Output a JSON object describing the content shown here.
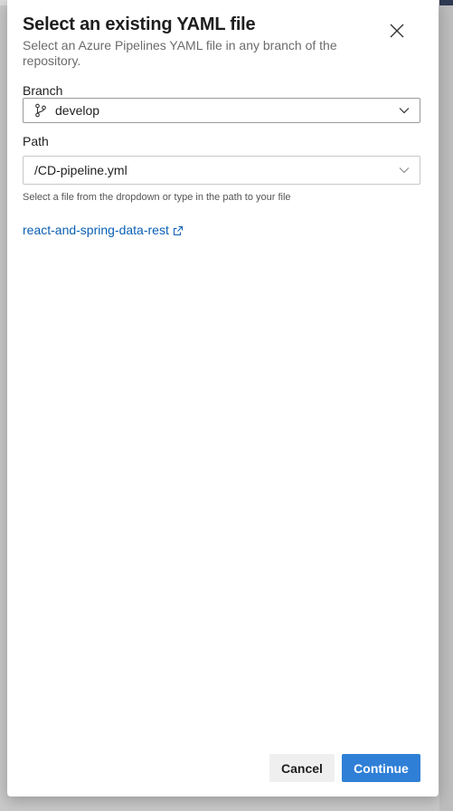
{
  "dialog": {
    "title": "Select an existing YAML file",
    "subtitle": "Select an Azure Pipelines YAML file in any branch of the repository.",
    "close_icon": "close-icon"
  },
  "branch": {
    "label": "Branch",
    "value": "develop",
    "icon": "git-branch-icon",
    "dropdown_icon": "chevron-down-icon"
  },
  "path": {
    "label": "Path",
    "value": "/CD-pipeline.yml",
    "dropdown_icon": "chevron-down-icon",
    "helper": "Select a file from the dropdown or type in the path to your file"
  },
  "repo_link": {
    "text": "react-and-spring-data-rest",
    "icon": "external-link-icon"
  },
  "footer": {
    "cancel_label": "Cancel",
    "continue_label": "Continue"
  },
  "colors": {
    "primary": "#2f7fd6",
    "link": "#0a5fb4"
  }
}
